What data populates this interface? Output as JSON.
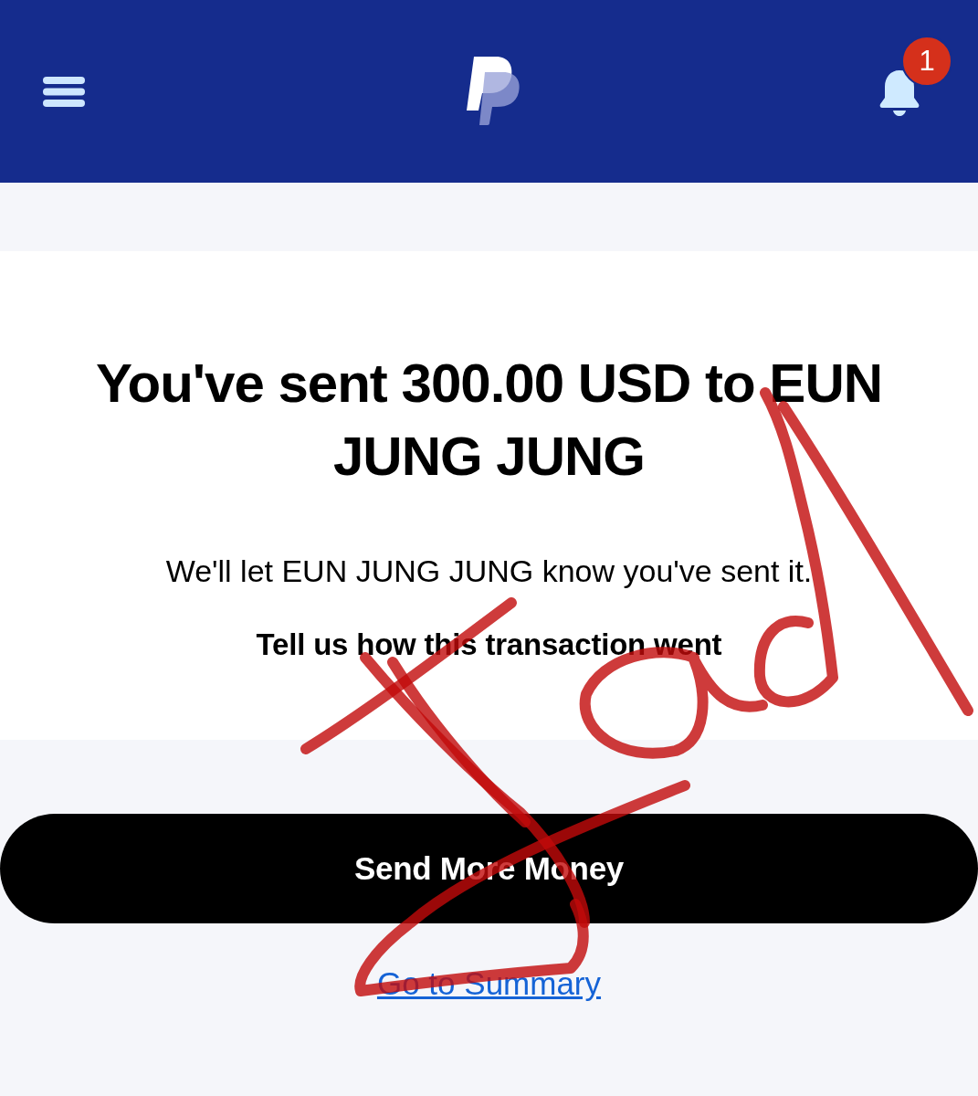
{
  "header": {
    "notification_count": "1"
  },
  "confirmation": {
    "title": "You've sent 300.00 USD to EUN JUNG JUNG",
    "message": "We'll let EUN JUNG JUNG know you've sent it.",
    "feedback_prompt": "Tell us how this transaction went"
  },
  "actions": {
    "primary_button": "Send More Money",
    "summary_link": "Go to Summary"
  }
}
